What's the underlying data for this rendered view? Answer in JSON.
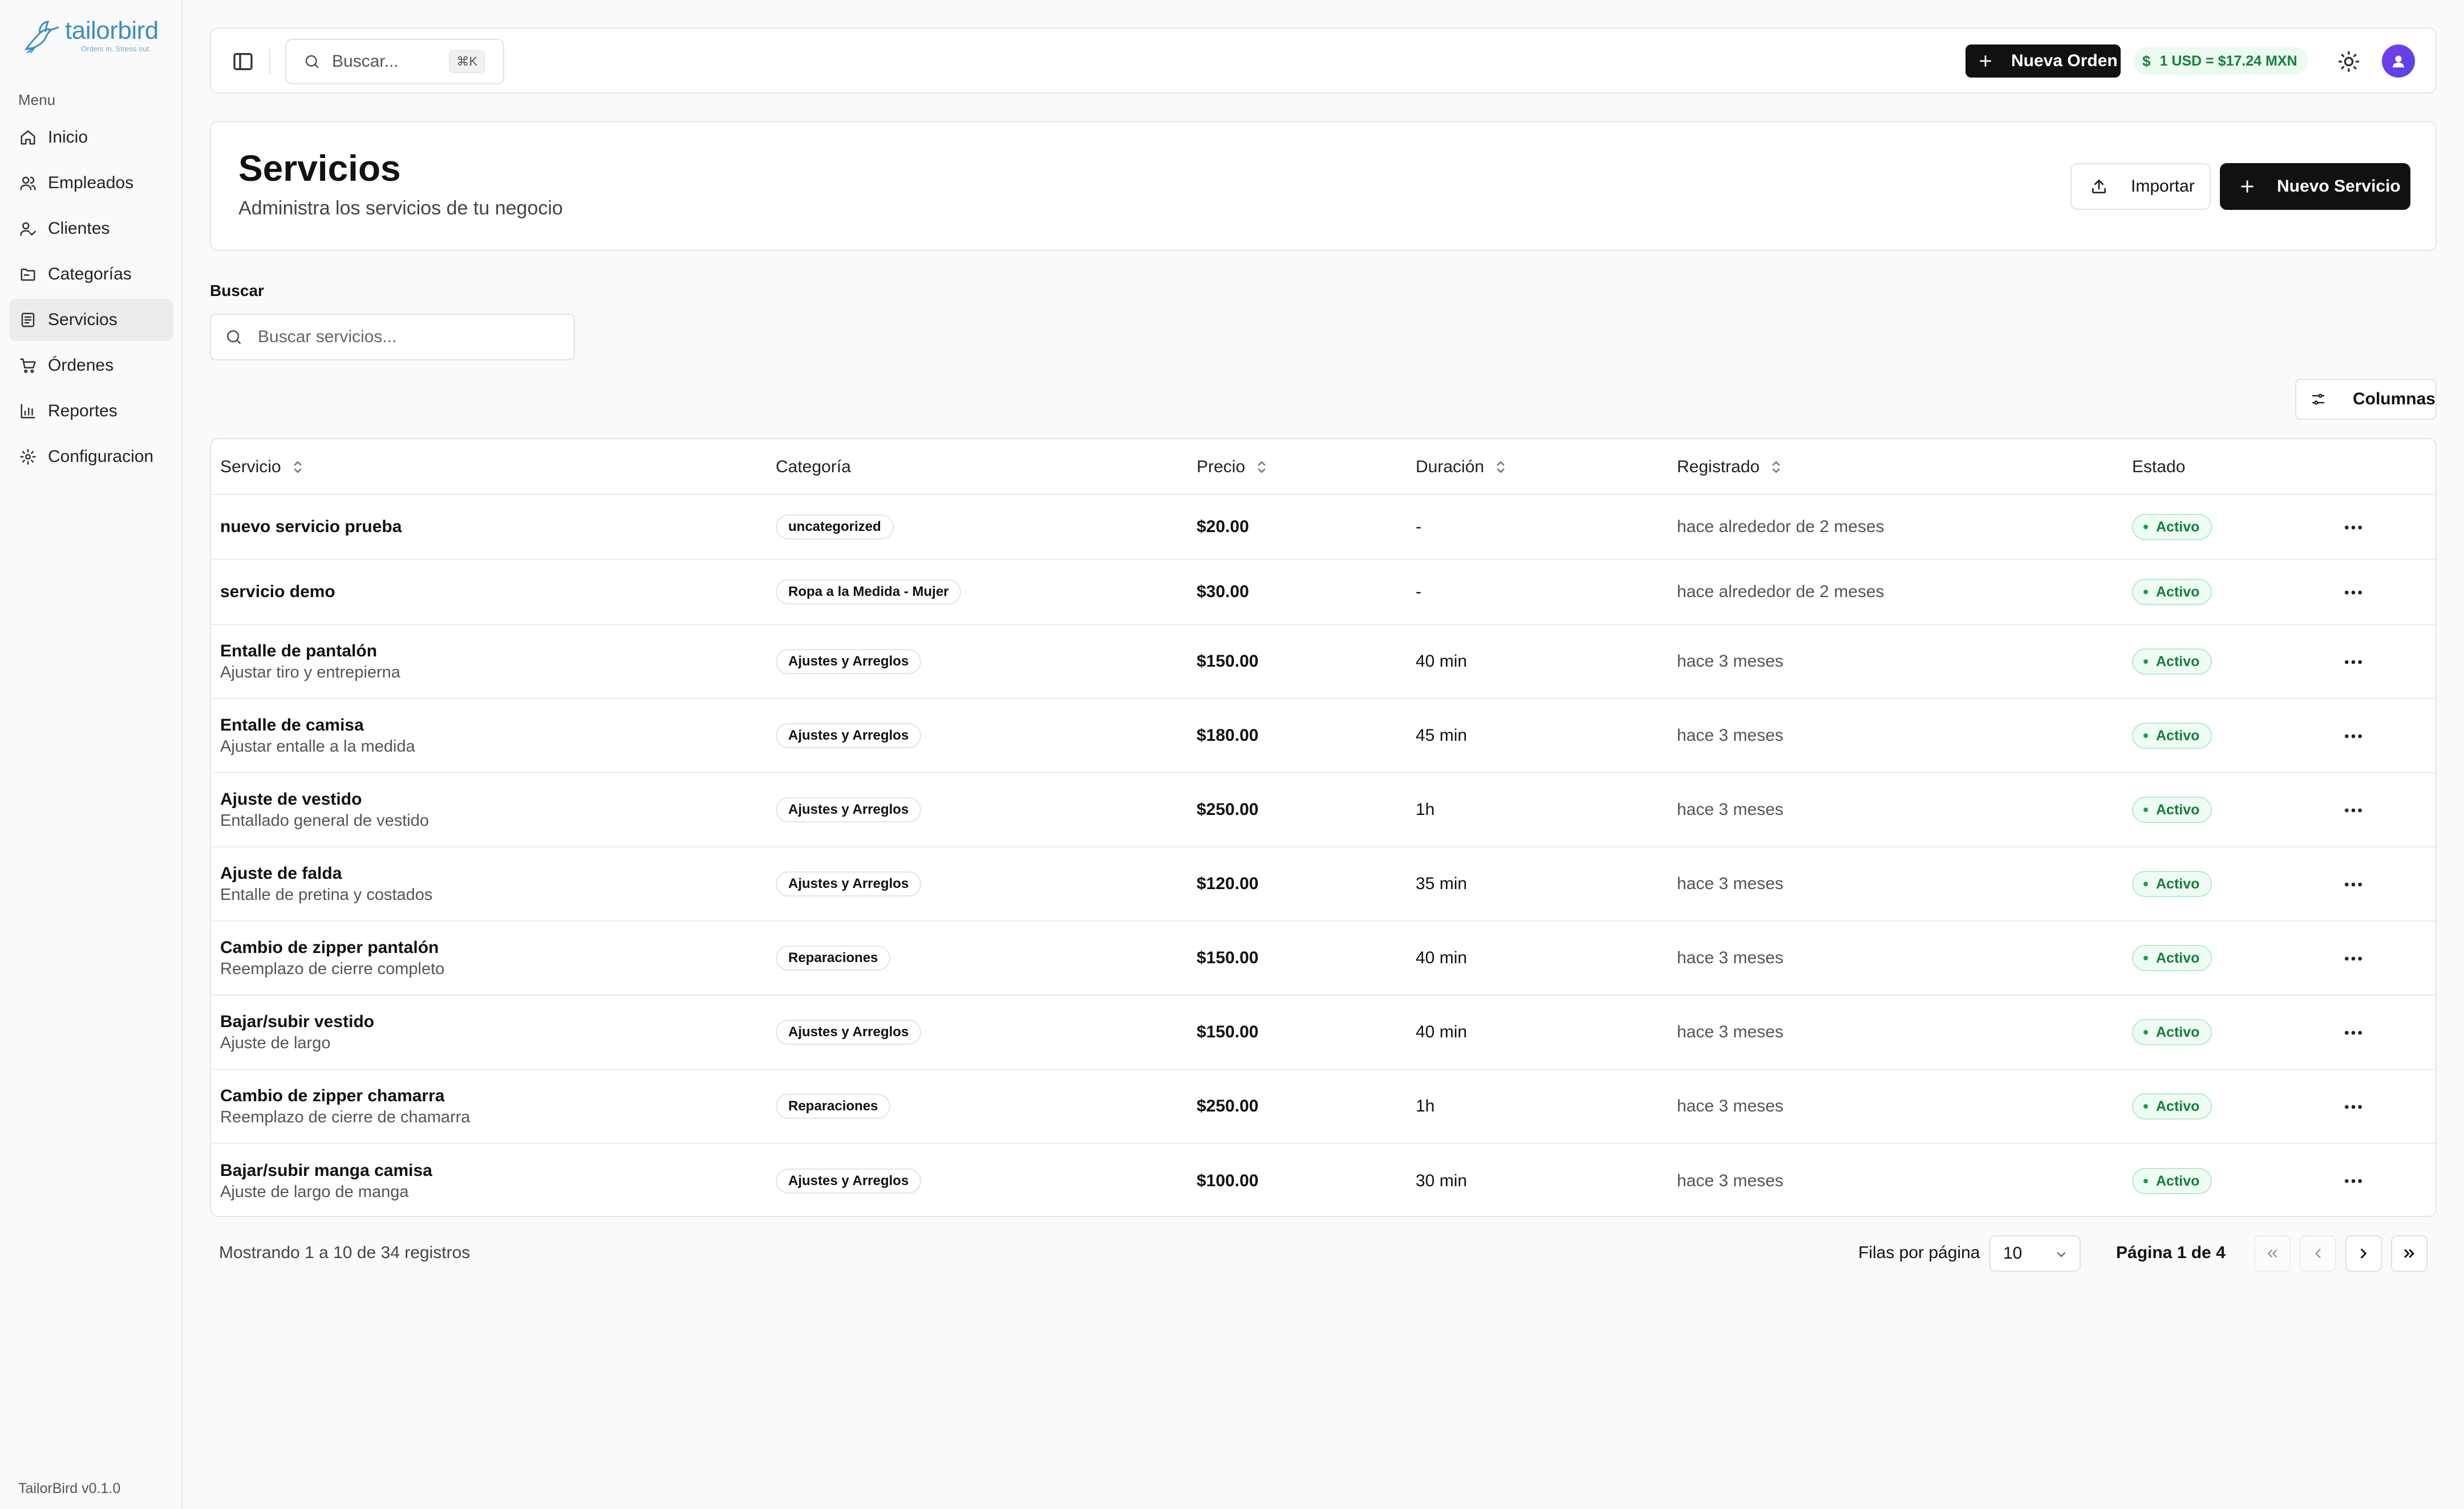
{
  "brand": {
    "name": "tailorbird",
    "tagline": "Orders in. Stress out.",
    "accent_color": "#3b8ec4"
  },
  "sidebar": {
    "menu_label": "Menu",
    "items": [
      {
        "label": "Inicio",
        "icon": "home-icon",
        "active": false
      },
      {
        "label": "Empleados",
        "icon": "users-icon",
        "active": false
      },
      {
        "label": "Clientes",
        "icon": "user-check-icon",
        "active": false
      },
      {
        "label": "Categorías",
        "icon": "folder-icon",
        "active": false
      },
      {
        "label": "Servicios",
        "icon": "list-icon",
        "active": true
      },
      {
        "label": "Órdenes",
        "icon": "cart-icon",
        "active": false
      },
      {
        "label": "Reportes",
        "icon": "bar-chart-icon",
        "active": false
      },
      {
        "label": "Configuracion",
        "icon": "gear-icon",
        "active": false
      }
    ],
    "version": "TailorBird v0.1.0"
  },
  "topbar": {
    "search_placeholder": "Buscar...",
    "search_shortcut": "⌘K",
    "new_order_label": "Nueva Orden",
    "exchange_symbol": "$",
    "exchange_rate": "1 USD = $17.24 MXN"
  },
  "header": {
    "title": "Servicios",
    "subtitle": "Administra los servicios de tu negocio",
    "import_label": "Importar",
    "new_service_label": "Nuevo Servicio"
  },
  "search": {
    "label": "Buscar",
    "placeholder": "Buscar servicios..."
  },
  "columns_button_label": "Columnas",
  "table": {
    "headers": {
      "service": "Servicio",
      "category": "Categoría",
      "price": "Precio",
      "duration": "Duración",
      "registered": "Registrado",
      "status": "Estado"
    },
    "rows": [
      {
        "name": "nuevo servicio prueba",
        "desc": "",
        "category": "uncategorized",
        "price": "$20.00",
        "duration": "-",
        "registered": "hace alrededor de 2 meses",
        "status": "Activo"
      },
      {
        "name": "servicio demo",
        "desc": "",
        "category": "Ropa a la Medida - Mujer",
        "price": "$30.00",
        "duration": "-",
        "registered": "hace alrededor de 2 meses",
        "status": "Activo"
      },
      {
        "name": "Entalle de pantalón",
        "desc": "Ajustar tiro y entrepierna",
        "category": "Ajustes y Arreglos",
        "price": "$150.00",
        "duration": "40 min",
        "registered": "hace 3 meses",
        "status": "Activo"
      },
      {
        "name": "Entalle de camisa",
        "desc": "Ajustar entalle a la medida",
        "category": "Ajustes y Arreglos",
        "price": "$180.00",
        "duration": "45 min",
        "registered": "hace 3 meses",
        "status": "Activo"
      },
      {
        "name": "Ajuste de vestido",
        "desc": "Entallado general de vestido",
        "category": "Ajustes y Arreglos",
        "price": "$250.00",
        "duration": "1h",
        "registered": "hace 3 meses",
        "status": "Activo"
      },
      {
        "name": "Ajuste de falda",
        "desc": "Entalle de pretina y costados",
        "category": "Ajustes y Arreglos",
        "price": "$120.00",
        "duration": "35 min",
        "registered": "hace 3 meses",
        "status": "Activo"
      },
      {
        "name": "Cambio de zipper pantalón",
        "desc": "Reemplazo de cierre completo",
        "category": "Reparaciones",
        "price": "$150.00",
        "duration": "40 min",
        "registered": "hace 3 meses",
        "status": "Activo"
      },
      {
        "name": "Bajar/subir vestido",
        "desc": "Ajuste de largo",
        "category": "Ajustes y Arreglos",
        "price": "$150.00",
        "duration": "40 min",
        "registered": "hace 3 meses",
        "status": "Activo"
      },
      {
        "name": "Cambio de zipper chamarra",
        "desc": "Reemplazo de cierre de chamarra",
        "category": "Reparaciones",
        "price": "$250.00",
        "duration": "1h",
        "registered": "hace 3 meses",
        "status": "Activo"
      },
      {
        "name": "Bajar/subir manga camisa",
        "desc": "Ajuste de largo de manga",
        "category": "Ajustes y Arreglos",
        "price": "$100.00",
        "duration": "30 min",
        "registered": "hace 3 meses",
        "status": "Activo"
      }
    ]
  },
  "pagination": {
    "showing_text": "Mostrando 1 a 10 de 34 registros",
    "rows_per_page_label": "Filas por página",
    "rows_per_page_value": "10",
    "page_info": "Página 1 de 4"
  },
  "colors": {
    "primary_button": "#111111",
    "status_active": "#14803d",
    "exchange_badge_bg": "#ecfbf2",
    "avatar": "#6d4ae8"
  }
}
